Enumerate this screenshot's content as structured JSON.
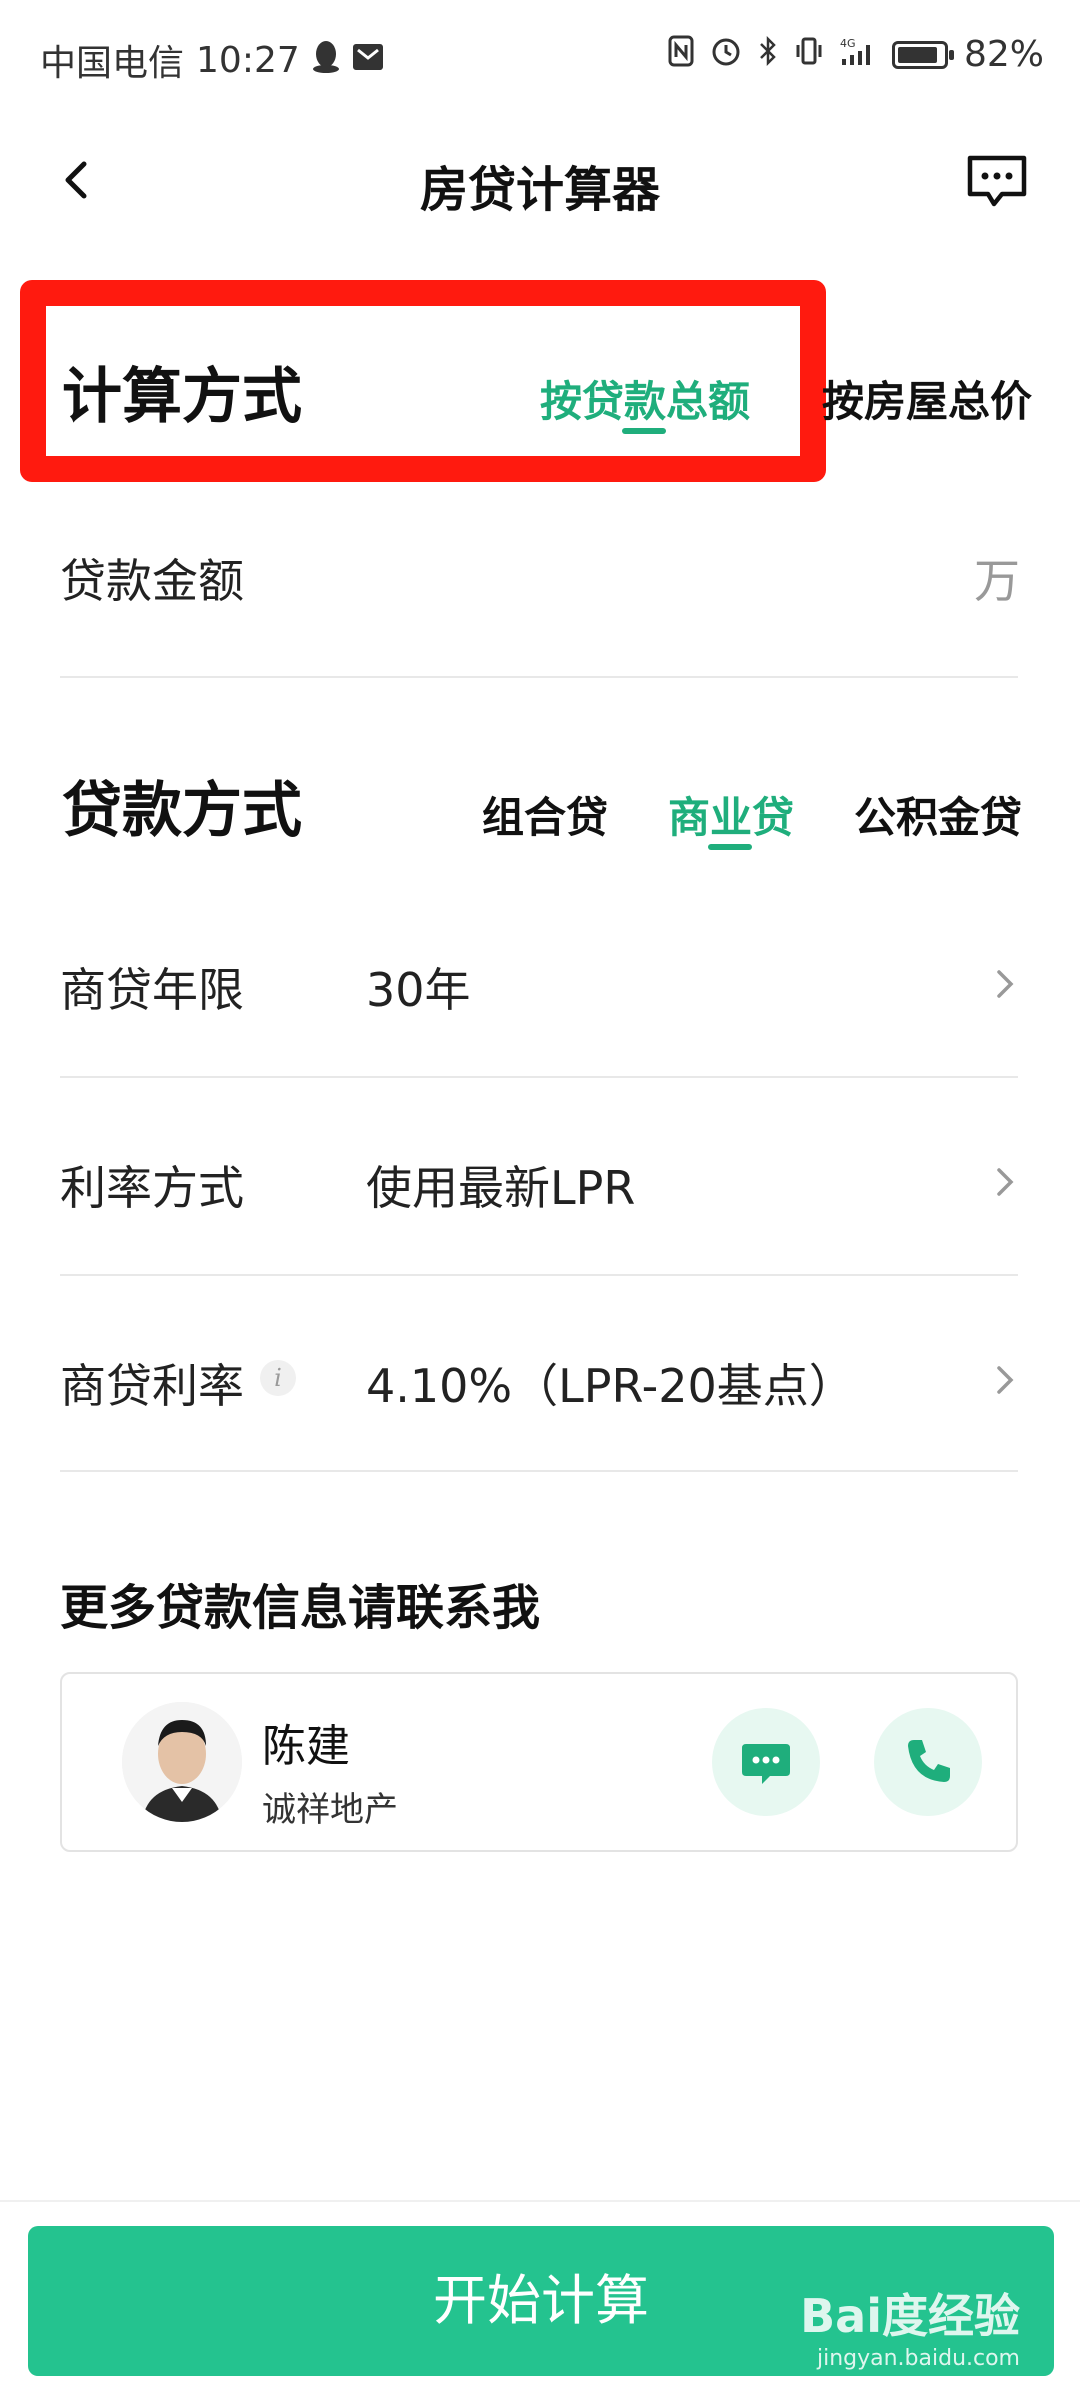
{
  "status_bar": {
    "carrier": "中国电信",
    "time": "10:27",
    "battery": "82%",
    "icons": [
      "qq-penguin-icon",
      "message-envelope-icon",
      "nfc-icon",
      "alarm-icon",
      "bluetooth-icon",
      "vibrate-icon",
      "signal-4g-icon",
      "battery-icon"
    ]
  },
  "header": {
    "title": "房贷计算器",
    "back_icon": "chevron-left-icon",
    "feedback_icon": "chat-bubble-icon"
  },
  "calc_method": {
    "title": "计算方式",
    "tabs": [
      {
        "label": "按贷款总额",
        "active": true
      },
      {
        "label": "按房屋总价",
        "active": false
      }
    ]
  },
  "loan_amount": {
    "label": "贷款金额",
    "unit": "万",
    "value": ""
  },
  "loan_type": {
    "title": "贷款方式",
    "tabs": [
      {
        "label": "组合贷",
        "active": false
      },
      {
        "label": "商业贷",
        "active": true
      },
      {
        "label": "公积金贷",
        "active": false
      }
    ]
  },
  "rows": [
    {
      "label": "商贷年限",
      "value": "30年"
    },
    {
      "label": "利率方式",
      "value": "使用最新LPR"
    },
    {
      "label": "商贷利率",
      "value": "4.10%（LPR-20基点）",
      "info_icon": "i"
    }
  ],
  "contact": {
    "heading": "更多贷款信息请联系我",
    "name": "陈建",
    "company": "诚祥地产"
  },
  "footer": {
    "start_button": "开始计算"
  },
  "watermark": {
    "logo": "Bai度经验",
    "url": "jingyan.baidu.com"
  },
  "colors": {
    "accent": "#1fae7c",
    "button": "#24c38f",
    "highlight_frame": "#ff1a0f"
  }
}
